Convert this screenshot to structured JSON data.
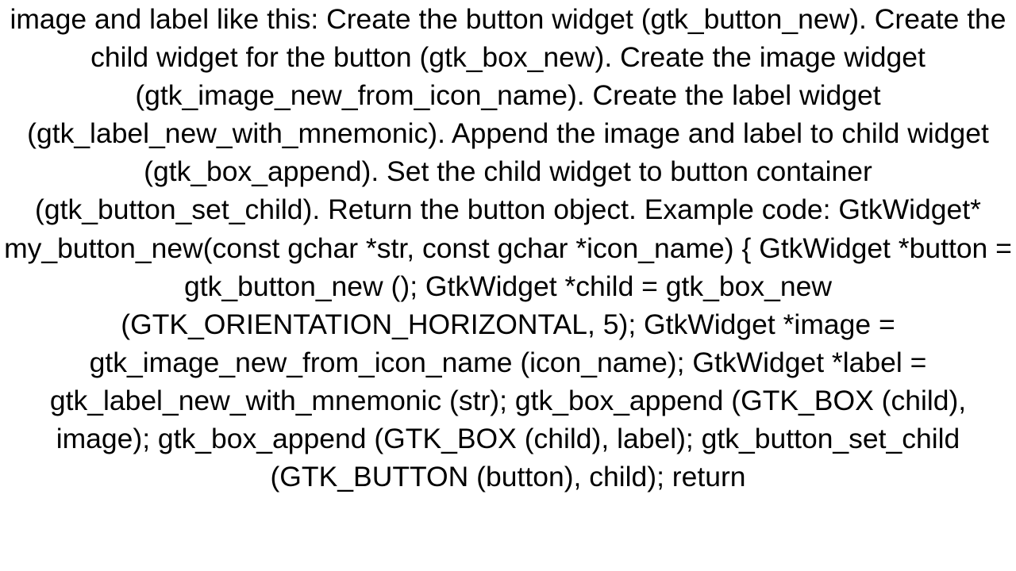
{
  "document": {
    "body_text": "image and label like this:  Create the button widget (gtk_button_new).  Create the child widget for the button (gtk_box_new).  Create the image widget (gtk_image_new_from_icon_name).  Create the label widget (gtk_label_new_with_mnemonic).  Append the image and label to child widget (gtk_box_append).  Set the child widget to button container (gtk_button_set_child).  Return the button object. Example code: GtkWidget* my_button_new(const gchar *str, const gchar *icon_name) { GtkWidget *button = gtk_button_new (); GtkWidget *child = gtk_box_new (GTK_ORIENTATION_HORIZONTAL, 5); GtkWidget *image = gtk_image_new_from_icon_name (icon_name); GtkWidget *label = gtk_label_new_with_mnemonic (str); gtk_box_append (GTK_BOX (child), image); gtk_box_append (GTK_BOX (child), label); gtk_button_set_child (GTK_BUTTON (button), child); return"
  }
}
